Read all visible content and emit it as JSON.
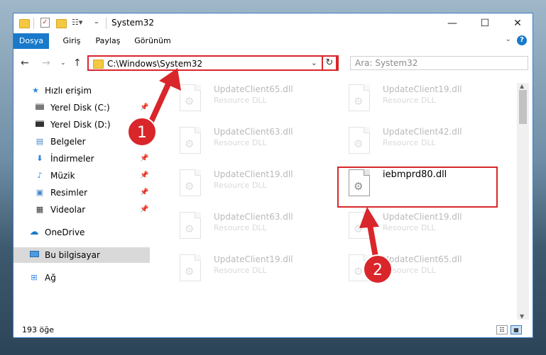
{
  "window": {
    "title": "System32",
    "controls": {
      "minimize": "—",
      "maximize": "☐",
      "close": "✕"
    }
  },
  "ribbon": {
    "tabs": [
      "Dosya",
      "Giriş",
      "Paylaş",
      "Görünüm"
    ],
    "help": "?"
  },
  "navbar": {
    "path": "C:\\Windows\\System32",
    "search_placeholder": "Ara: System32"
  },
  "sidebar": {
    "items": [
      {
        "label": "Hızlı erişim",
        "icon": "star-icon",
        "pinned": false
      },
      {
        "label": "Yerel Disk (C:)",
        "icon": "drive-icon",
        "pinned": true
      },
      {
        "label": "Yerel Disk (D:)",
        "icon": "drive-icon",
        "pinned": false
      },
      {
        "label": "Belgeler",
        "icon": "documents-icon",
        "pinned": true
      },
      {
        "label": "İndirmeler",
        "icon": "download-icon",
        "pinned": true
      },
      {
        "label": "Müzik",
        "icon": "music-icon",
        "pinned": true
      },
      {
        "label": "Resimler",
        "icon": "pictures-icon",
        "pinned": true
      },
      {
        "label": "Videolar",
        "icon": "videos-icon",
        "pinned": true
      },
      {
        "label": "OneDrive",
        "icon": "cloud-icon",
        "pinned": false
      },
      {
        "label": "Bu bilgisayar",
        "icon": "computer-icon",
        "pinned": false,
        "selected": true
      },
      {
        "label": "Ağ",
        "icon": "network-icon",
        "pinned": false
      }
    ]
  },
  "files": [
    {
      "name": "UpdateClient65.dll",
      "type": "Resource DLL"
    },
    {
      "name": "UpdateClient19.dll",
      "type": "Resource DLL"
    },
    {
      "name": "UpdateClient63.dll",
      "type": "Resource DLL"
    },
    {
      "name": "UpdateClient42.dll",
      "type": "Resource DLL"
    },
    {
      "name": "UpdateClient19.dll",
      "type": "Resource DLL"
    },
    {
      "name": "iebmprd80.dll",
      "type": ""
    },
    {
      "name": "UpdateClient63.dll",
      "type": "Resource DLL"
    },
    {
      "name": "UpdateClient19.dll",
      "type": "Resource DLL"
    },
    {
      "name": "UpdateClient19.dll",
      "type": "Resource DLL"
    },
    {
      "name": "UpdateClient65.dll",
      "type": "Resource DLL"
    }
  ],
  "status": {
    "count": "193 öğe"
  },
  "annotations": {
    "step1": "1",
    "step2": "2",
    "color": "#d9262b"
  }
}
